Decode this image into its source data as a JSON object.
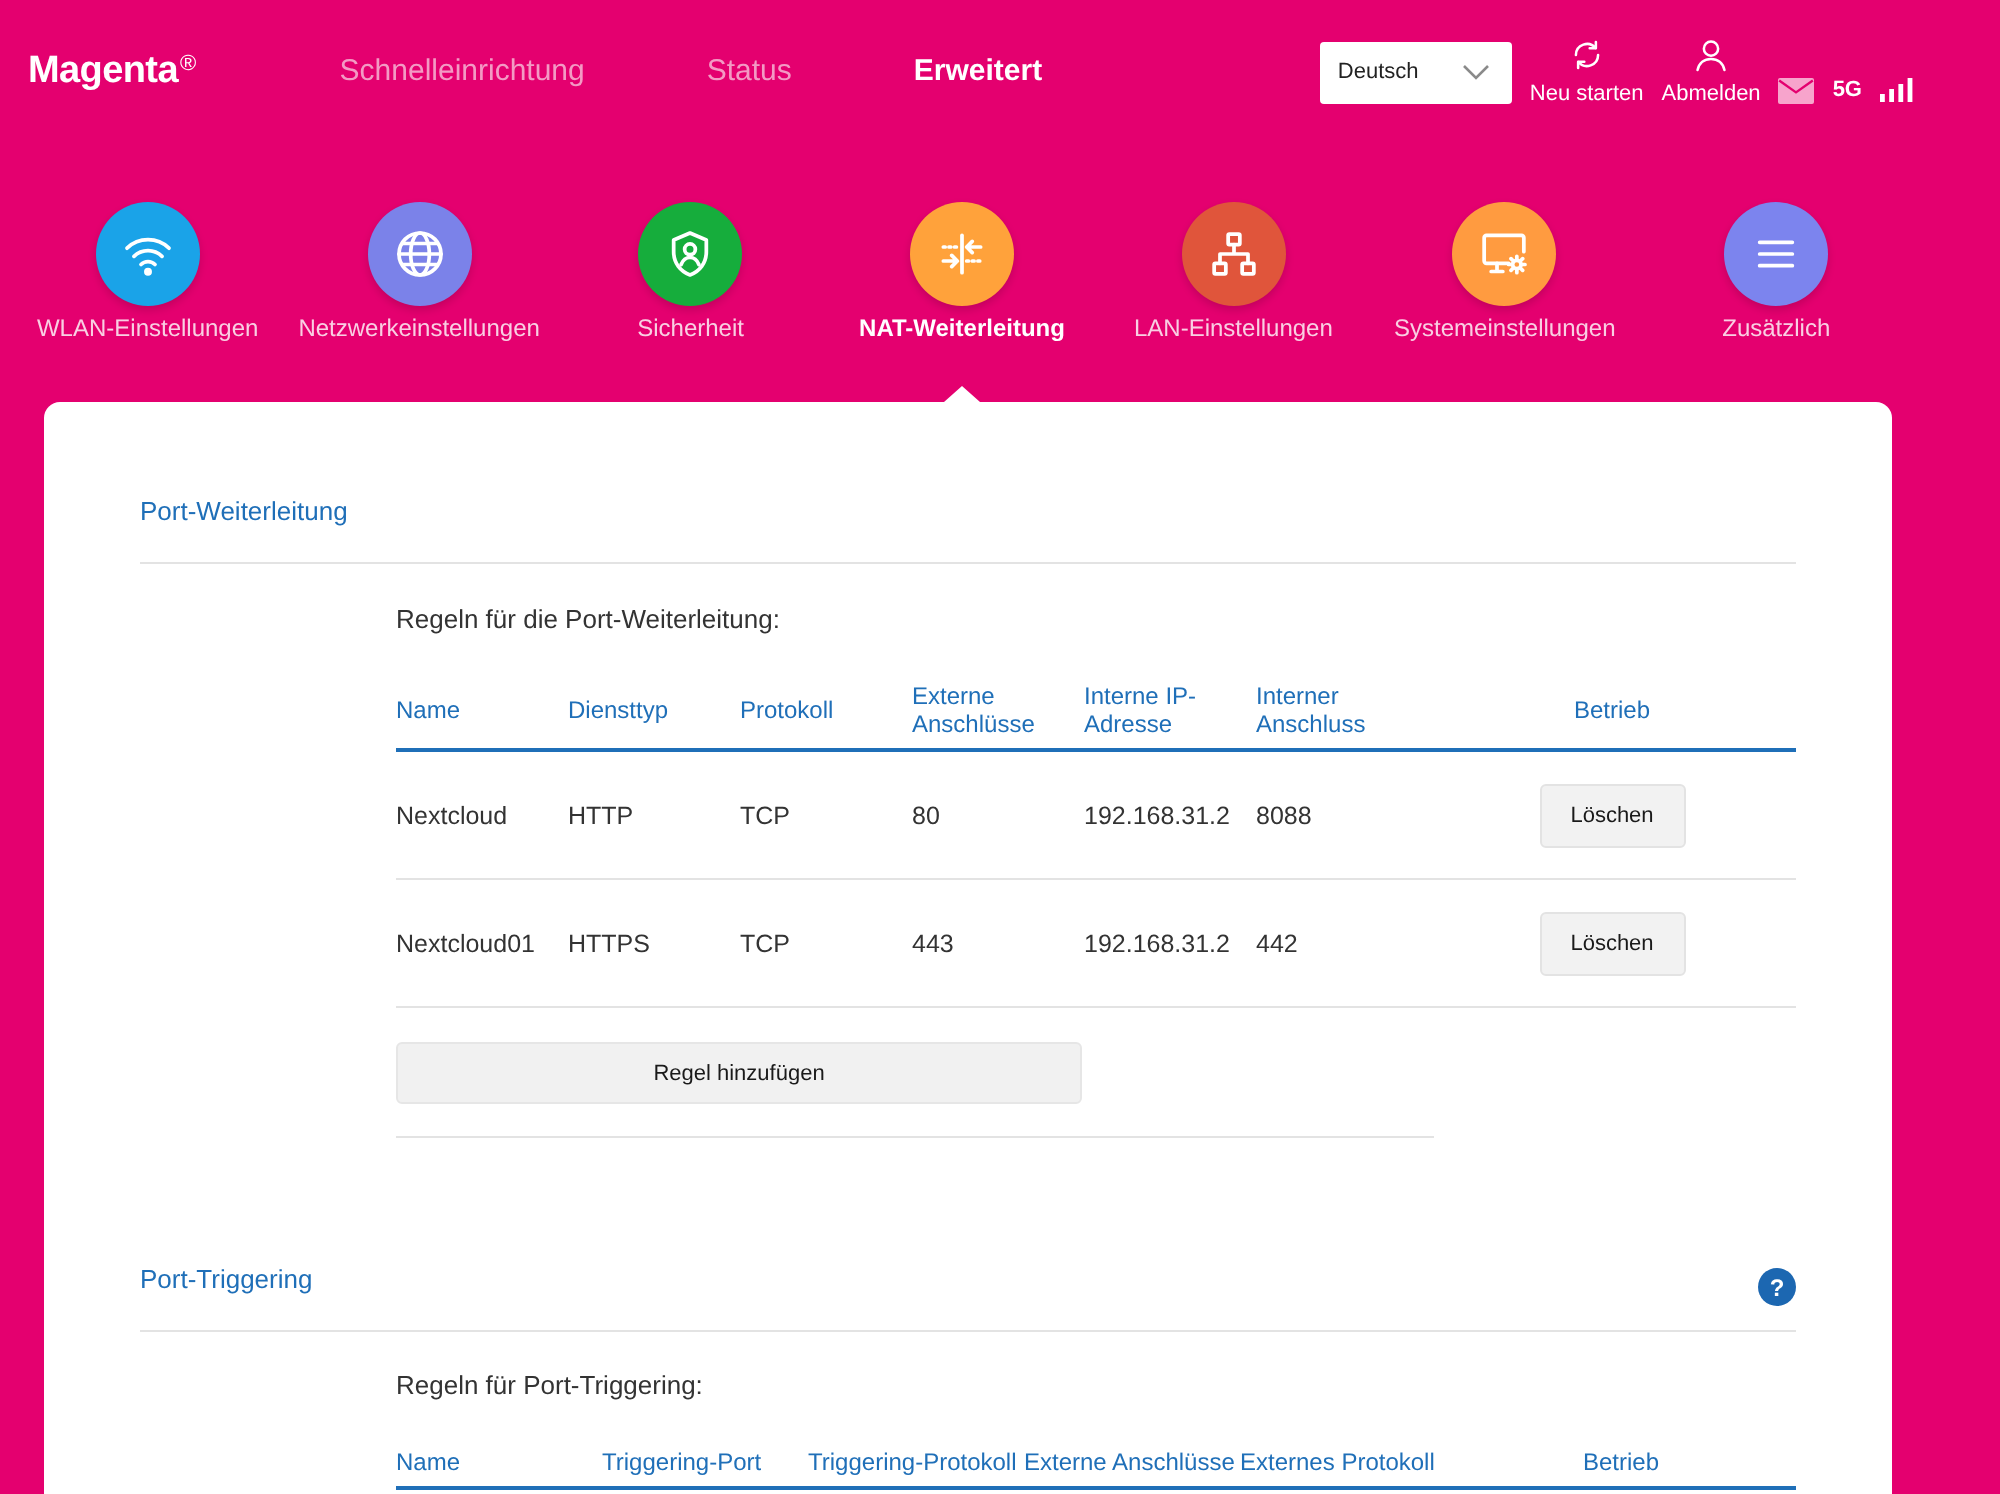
{
  "header": {
    "logo": "Magenta$^{®}$",
    "nav": [
      {
        "label": "Schnelleinrichtung",
        "selected": false
      },
      {
        "label": "Status",
        "selected": false
      },
      {
        "label": "Erweitert",
        "selected": true
      }
    ],
    "language": "Deutsch",
    "actions": [
      {
        "label": "Neu starten"
      },
      {
        "label": "Abmelden"
      }
    ],
    "network": "5G"
  },
  "categories": [
    {
      "label": "WLAN-Einstellungen",
      "color": "#1aa3e8",
      "selected": false
    },
    {
      "label": "Netzwerkeinstellungen",
      "color": "#7b82e9",
      "selected": false
    },
    {
      "label": "Sicherheit",
      "color": "#16ad3c",
      "selected": false
    },
    {
      "label": "NAT-Weiterleitung",
      "color": "#ffa23b",
      "selected": true
    },
    {
      "label": "LAN-Einstellungen",
      "color": "#e0553b",
      "selected": false
    },
    {
      "label": "Systemeinstellungen",
      "color": "#ff9b40",
      "selected": false
    },
    {
      "label": "Zusätzlich",
      "color": "#7c84ee",
      "selected": false
    }
  ],
  "port_forwarding": {
    "title": "Port-Weiterleitung",
    "rules_label": "Regeln für die Port-Weiterleitung:",
    "columns": [
      "Name",
      "Diensttyp",
      "Protokoll",
      "Externe Anschlüsse",
      "Interne IP-Adresse",
      "Interner Anschluss",
      "Betrieb"
    ],
    "rows": [
      {
        "cells": [
          "Nextcloud",
          "HTTP",
          "TCP",
          "80",
          "192.168.31.2",
          "8088"
        ],
        "action": "Löschen"
      },
      {
        "cells": [
          "Nextcloud01",
          "HTTPS",
          "TCP",
          "443",
          "192.168.31.2",
          "442"
        ],
        "action": "Löschen"
      }
    ],
    "add_button": "Regel hinzufügen"
  },
  "port_triggering": {
    "title": "Port-Triggering",
    "help": "?",
    "rules_label": "Regeln für Port-Triggering:",
    "columns": [
      "Name",
      "Triggering-Port",
      "Triggering-Protokoll",
      "Externe Anschlüsse",
      "Externes Protokoll",
      "Betrieb"
    ]
  }
}
